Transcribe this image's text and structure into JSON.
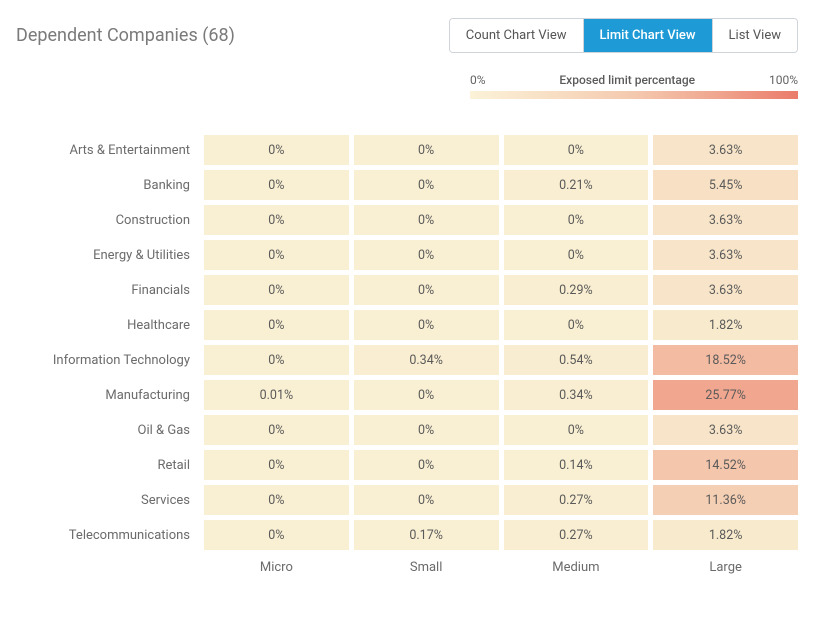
{
  "header": {
    "title": "Dependent Companies (68)",
    "views": {
      "count": "Count Chart View",
      "limit": "Limit Chart View",
      "list": "List View"
    }
  },
  "legend": {
    "min_label": "0%",
    "center_label": "Exposed limit percentage",
    "max_label": "100%"
  },
  "chart_data": {
    "type": "heatmap",
    "xlabel": "",
    "ylabel": "",
    "x_categories": [
      "Micro",
      "Small",
      "Medium",
      "Large"
    ],
    "y_categories": [
      "Arts & Entertainment",
      "Banking",
      "Construction",
      "Energy & Utilities",
      "Financials",
      "Healthcare",
      "Information Technology",
      "Manufacturing",
      "Oil & Gas",
      "Retail",
      "Services",
      "Telecommunications"
    ],
    "values": [
      [
        0,
        0,
        0,
        3.63
      ],
      [
        0,
        0,
        0.21,
        5.45
      ],
      [
        0,
        0,
        0,
        3.63
      ],
      [
        0,
        0,
        0,
        3.63
      ],
      [
        0,
        0,
        0.29,
        3.63
      ],
      [
        0,
        0,
        0,
        1.82
      ],
      [
        0,
        0.34,
        0.54,
        18.52
      ],
      [
        0.01,
        0,
        0.34,
        25.77
      ],
      [
        0,
        0,
        0,
        3.63
      ],
      [
        0,
        0,
        0.14,
        14.52
      ],
      [
        0,
        0,
        0.27,
        11.36
      ],
      [
        0,
        0.17,
        0.27,
        1.82
      ]
    ],
    "display": [
      [
        "0%",
        "0%",
        "0%",
        "3.63%"
      ],
      [
        "0%",
        "0%",
        "0.21%",
        "5.45%"
      ],
      [
        "0%",
        "0%",
        "0%",
        "3.63%"
      ],
      [
        "0%",
        "0%",
        "0%",
        "3.63%"
      ],
      [
        "0%",
        "0%",
        "0.29%",
        "3.63%"
      ],
      [
        "0%",
        "0%",
        "0%",
        "1.82%"
      ],
      [
        "0%",
        "0.34%",
        "0.54%",
        "18.52%"
      ],
      [
        "0.01%",
        "0%",
        "0.34%",
        "25.77%"
      ],
      [
        "0%",
        "0%",
        "0%",
        "3.63%"
      ],
      [
        "0%",
        "0%",
        "0.14%",
        "14.52%"
      ],
      [
        "0%",
        "0%",
        "0.27%",
        "11.36%"
      ],
      [
        "0%",
        "0.17%",
        "0.27%",
        "1.82%"
      ]
    ],
    "color_scale": {
      "min": 0,
      "max": 100
    }
  }
}
